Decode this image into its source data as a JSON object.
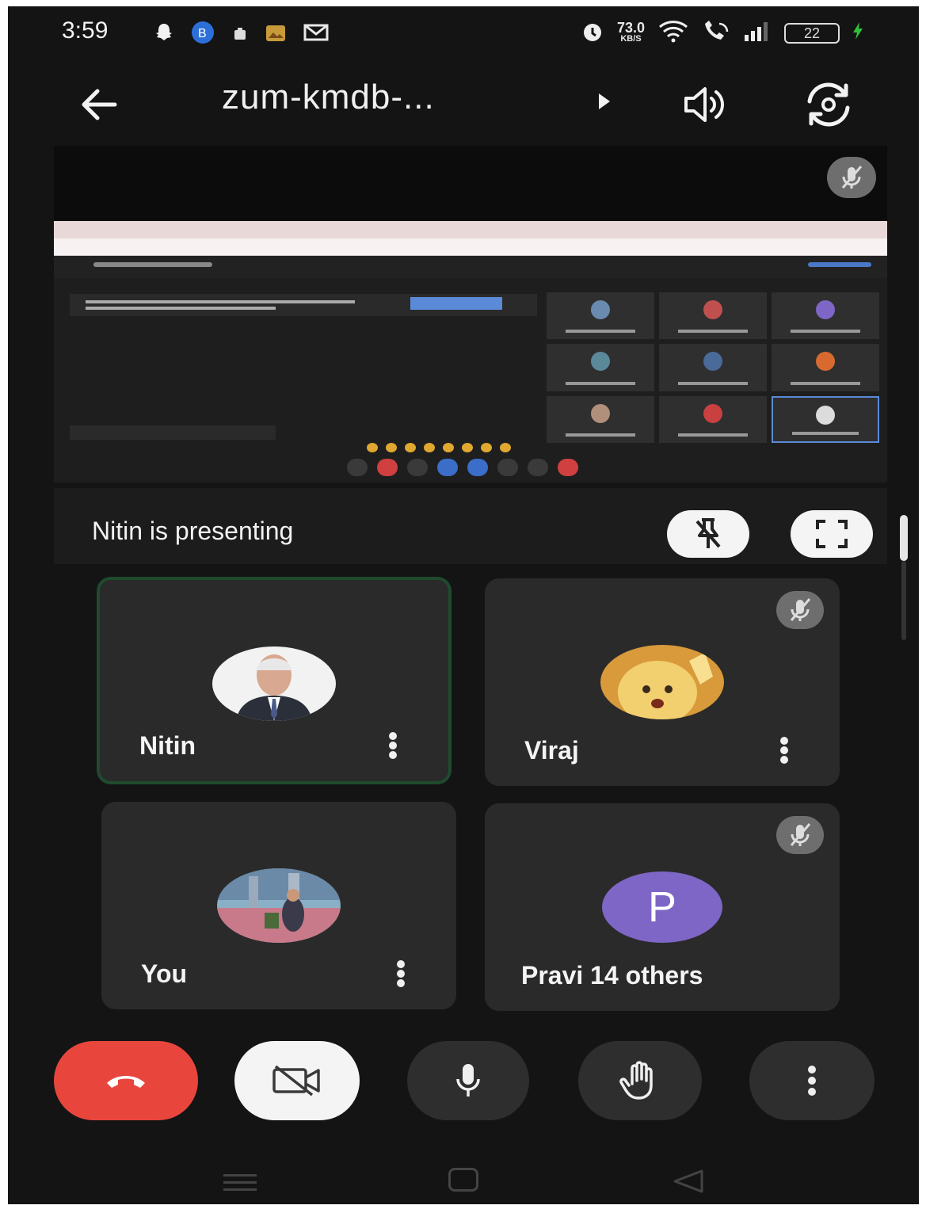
{
  "status_bar": {
    "time": "3:59",
    "network_speed": "73.0",
    "network_speed_unit": "KB/S",
    "battery": "22"
  },
  "header": {
    "meeting_code": "zum-kmdb-..."
  },
  "presentation": {
    "presenting_label": "Nitin is presenting"
  },
  "participants": [
    {
      "name": "Nitin",
      "muted": false,
      "speaking": true
    },
    {
      "name": "Viraj",
      "muted": true,
      "speaking": false
    },
    {
      "name": "You",
      "muted": false,
      "speaking": false
    },
    {
      "name": "Pravi 14 others",
      "initial": "P",
      "muted": true,
      "speaking": false
    }
  ],
  "colors": {
    "background": "#141414",
    "tile": "#2a2a2a",
    "hangup": "#e8463d",
    "active_border": "#1f4a2e",
    "initial_avatar": "#7e66c6"
  },
  "icons": {
    "status": [
      "snapchat-icon",
      "b-app-icon",
      "notification-icon",
      "gallery-icon",
      "gmail-icon",
      "alarm-icon",
      "wifi-icon",
      "wifi-call-icon",
      "signal-icon",
      "charging-icon"
    ],
    "header": [
      "back-arrow-icon",
      "dropdown-arrow-icon",
      "speaker-icon",
      "switch-camera-icon"
    ],
    "controls": [
      "hang-up-icon",
      "camera-off-icon",
      "microphone-icon",
      "raise-hand-icon",
      "more-vert-icon"
    ]
  }
}
